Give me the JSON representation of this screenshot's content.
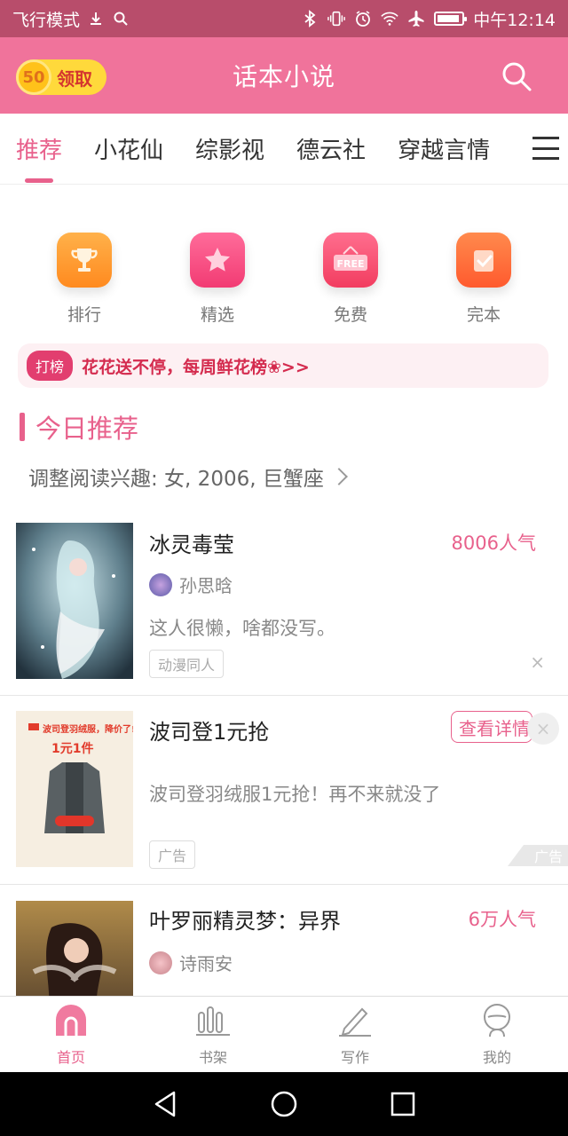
{
  "status_bar": {
    "left_text": "飞行模式",
    "time": "中午12:14"
  },
  "header": {
    "coin_value": "50",
    "coin_label": "领取",
    "title": "话本小说"
  },
  "tabs": [
    {
      "label": "推荐",
      "active": true
    },
    {
      "label": "小花仙",
      "active": false
    },
    {
      "label": "综影视",
      "active": false
    },
    {
      "label": "德云社",
      "active": false
    },
    {
      "label": "穿越言情",
      "active": false
    }
  ],
  "quick_entries": [
    {
      "label": "排行",
      "icon": "trophy-icon",
      "color": "#ff9a2e"
    },
    {
      "label": "精选",
      "icon": "star-icon",
      "color": "#f74c82"
    },
    {
      "label": "免费",
      "icon": "free-sign-icon",
      "color": "#f74c6e"
    },
    {
      "label": "完本",
      "icon": "check-note-icon",
      "color": "#ff6a3d"
    }
  ],
  "banner": {
    "tag": "打榜",
    "text": "花花送不停，每周鲜花榜❀>>"
  },
  "section": {
    "title": "今日推荐",
    "interest": "调整阅读兴趣: 女, 2006, 巨蟹座"
  },
  "cards": [
    {
      "name": "冰灵毒莹",
      "popularity": "8006人气",
      "author": "孙思晗",
      "desc": "这人很懒，啥都没写。",
      "tag": "动漫同人",
      "close": "×"
    },
    {
      "name": "波司登1元抢",
      "detail_button": "查看详情",
      "desc": "波司登羽绒服1元抢！再不来就没了",
      "tag": "广告",
      "ad_corner": "广告",
      "cover_head": "波司登羽绒服，降价了!",
      "cover_price": "1元1件",
      "close": "×"
    },
    {
      "name": "叶罗丽精灵梦：异界",
      "popularity": "6万人气",
      "author": "诗雨安"
    }
  ],
  "bottom_nav": [
    {
      "label": "首页",
      "icon": "home-icon",
      "active": true
    },
    {
      "label": "书架",
      "icon": "bookshelf-icon",
      "active": false
    },
    {
      "label": "写作",
      "icon": "pen-icon",
      "active": false
    },
    {
      "label": "我的",
      "icon": "profile-icon",
      "active": false
    }
  ],
  "colors": {
    "accent": "#e8618c",
    "header_bg": "#f0739b",
    "statusbar_bg": "#b84d6b"
  }
}
